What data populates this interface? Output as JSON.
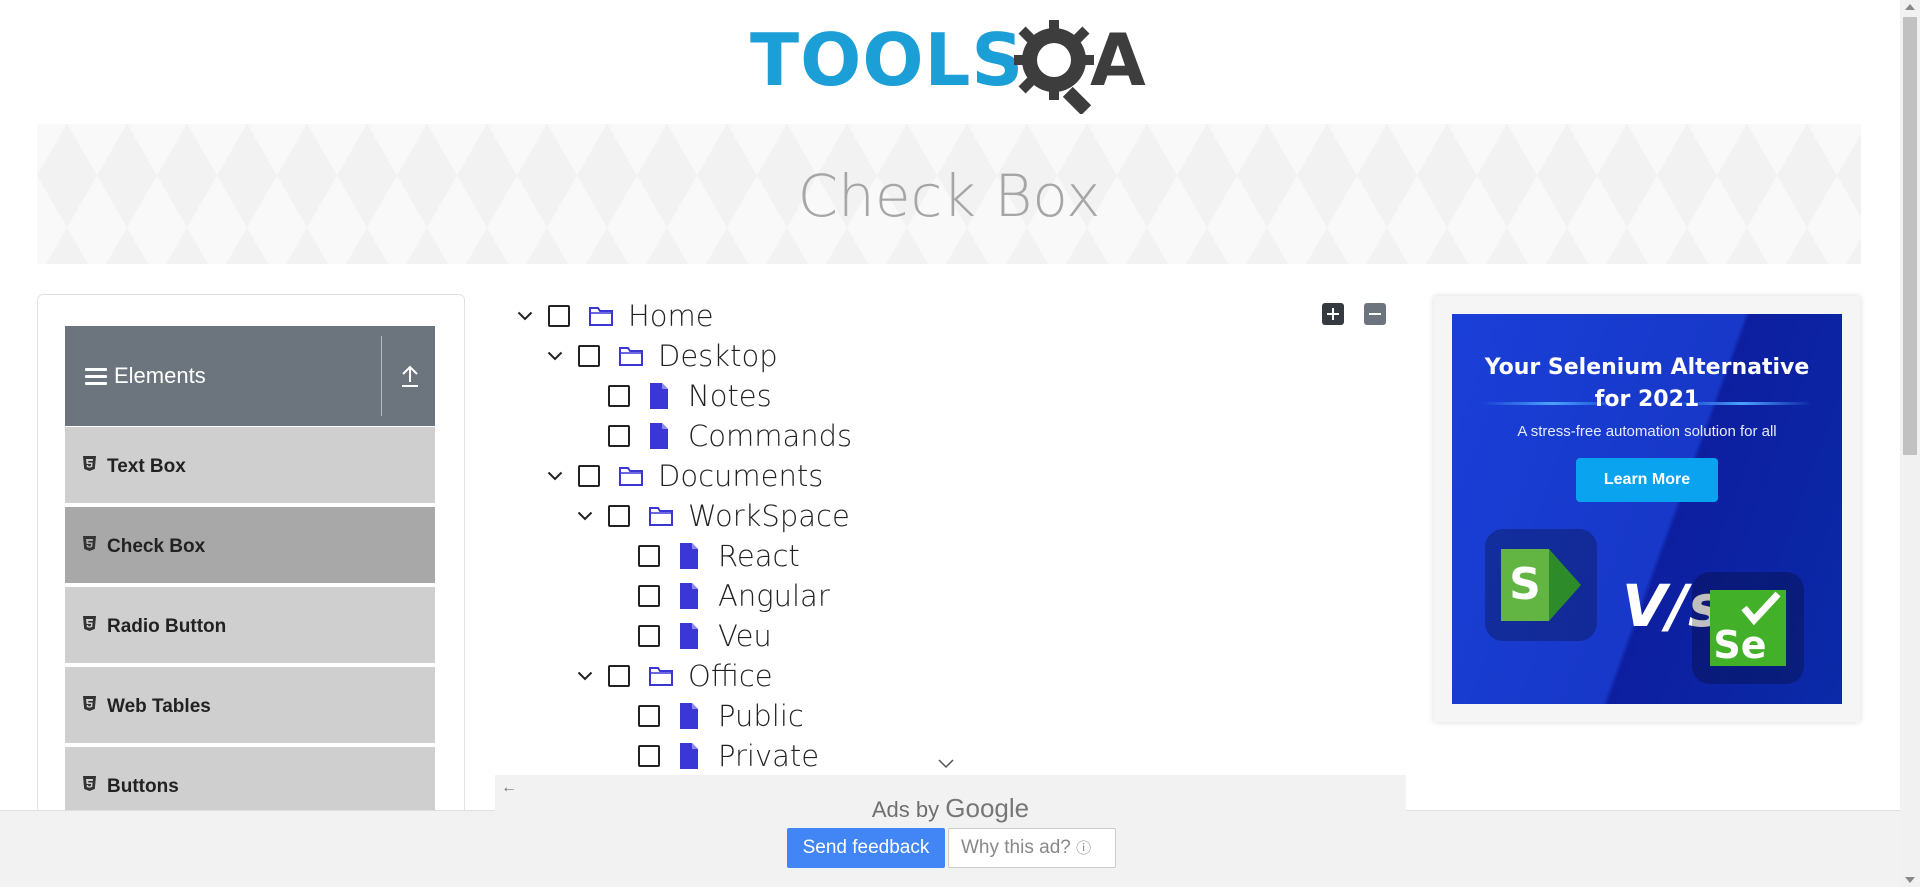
{
  "header": {
    "logo_tools": "TOOLS",
    "logo_a": "A",
    "brand_color": "#1b9fd6"
  },
  "banner": {
    "title": "Check Box"
  },
  "sidebar": {
    "group_title": "Elements",
    "items": [
      {
        "label": "Text Box",
        "active": false
      },
      {
        "label": "Check Box",
        "active": true
      },
      {
        "label": "Radio Button",
        "active": false
      },
      {
        "label": "Web Tables",
        "active": false
      },
      {
        "label": "Buttons",
        "active": false
      }
    ]
  },
  "tree": {
    "nodes": [
      {
        "label": "Home",
        "type": "folder",
        "level": 0,
        "expanded": true
      },
      {
        "label": "Desktop",
        "type": "folder",
        "level": 1,
        "expanded": true
      },
      {
        "label": "Notes",
        "type": "file",
        "level": 2
      },
      {
        "label": "Commands",
        "type": "file",
        "level": 2
      },
      {
        "label": "Documents",
        "type": "folder",
        "level": 1,
        "expanded": true
      },
      {
        "label": "WorkSpace",
        "type": "folder",
        "level": 2,
        "expanded": true
      },
      {
        "label": "React",
        "type": "file",
        "level": 3
      },
      {
        "label": "Angular",
        "type": "file",
        "level": 3
      },
      {
        "label": "Veu",
        "type": "file",
        "level": 3
      },
      {
        "label": "Office",
        "type": "folder",
        "level": 2,
        "expanded": true
      },
      {
        "label": "Public",
        "type": "file",
        "level": 3
      },
      {
        "label": "Private",
        "type": "file",
        "level": 3
      }
    ],
    "icon_color": "#3a37d6"
  },
  "ad": {
    "headline_line1": "Your Selenium Alternative",
    "headline_line2": "for 2021",
    "subline": "A stress-free automation solution for all",
    "button": "Learn More",
    "vs": "V/s",
    "left_logo_letter": "S",
    "right_logo_letters": "Se"
  },
  "google_ad": {
    "ads_by": "Ads by",
    "google": "Google",
    "send_feedback": "Send feedback",
    "why_this_ad": "Why this ad?"
  }
}
